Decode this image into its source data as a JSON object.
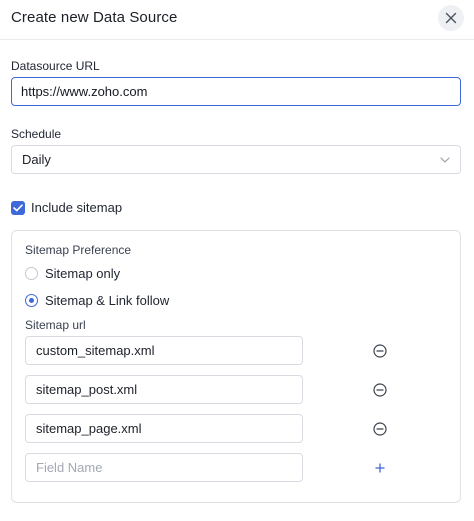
{
  "dialog": {
    "title": "Create new Data Source",
    "close_icon": "close-icon"
  },
  "datasource_url": {
    "label": "Datasource URL",
    "value": "https://www.zoho.com"
  },
  "schedule": {
    "label": "Schedule",
    "selected": "Daily",
    "chevron_icon": "chevron-down-icon"
  },
  "include_sitemap": {
    "label": "Include sitemap",
    "checked": true
  },
  "sitemap_preference": {
    "label": "Sitemap Preference",
    "options": [
      {
        "label": "Sitemap only",
        "selected": false
      },
      {
        "label": "Sitemap & Link follow",
        "selected": true
      }
    ]
  },
  "sitemap_url": {
    "label": "Sitemap url",
    "rows": [
      {
        "value": "custom_sitemap.xml",
        "action_icon": "remove-circle-icon"
      },
      {
        "value": "sitemap_post.xml",
        "action_icon": "remove-circle-icon"
      },
      {
        "value": "sitemap_page.xml",
        "action_icon": "remove-circle-icon"
      }
    ],
    "new_row": {
      "placeholder": "Field Name",
      "action_icon": "plus-icon"
    }
  },
  "colors": {
    "accent": "#3f68d8",
    "border": "#d8dbe1",
    "text": "#1f2430"
  }
}
